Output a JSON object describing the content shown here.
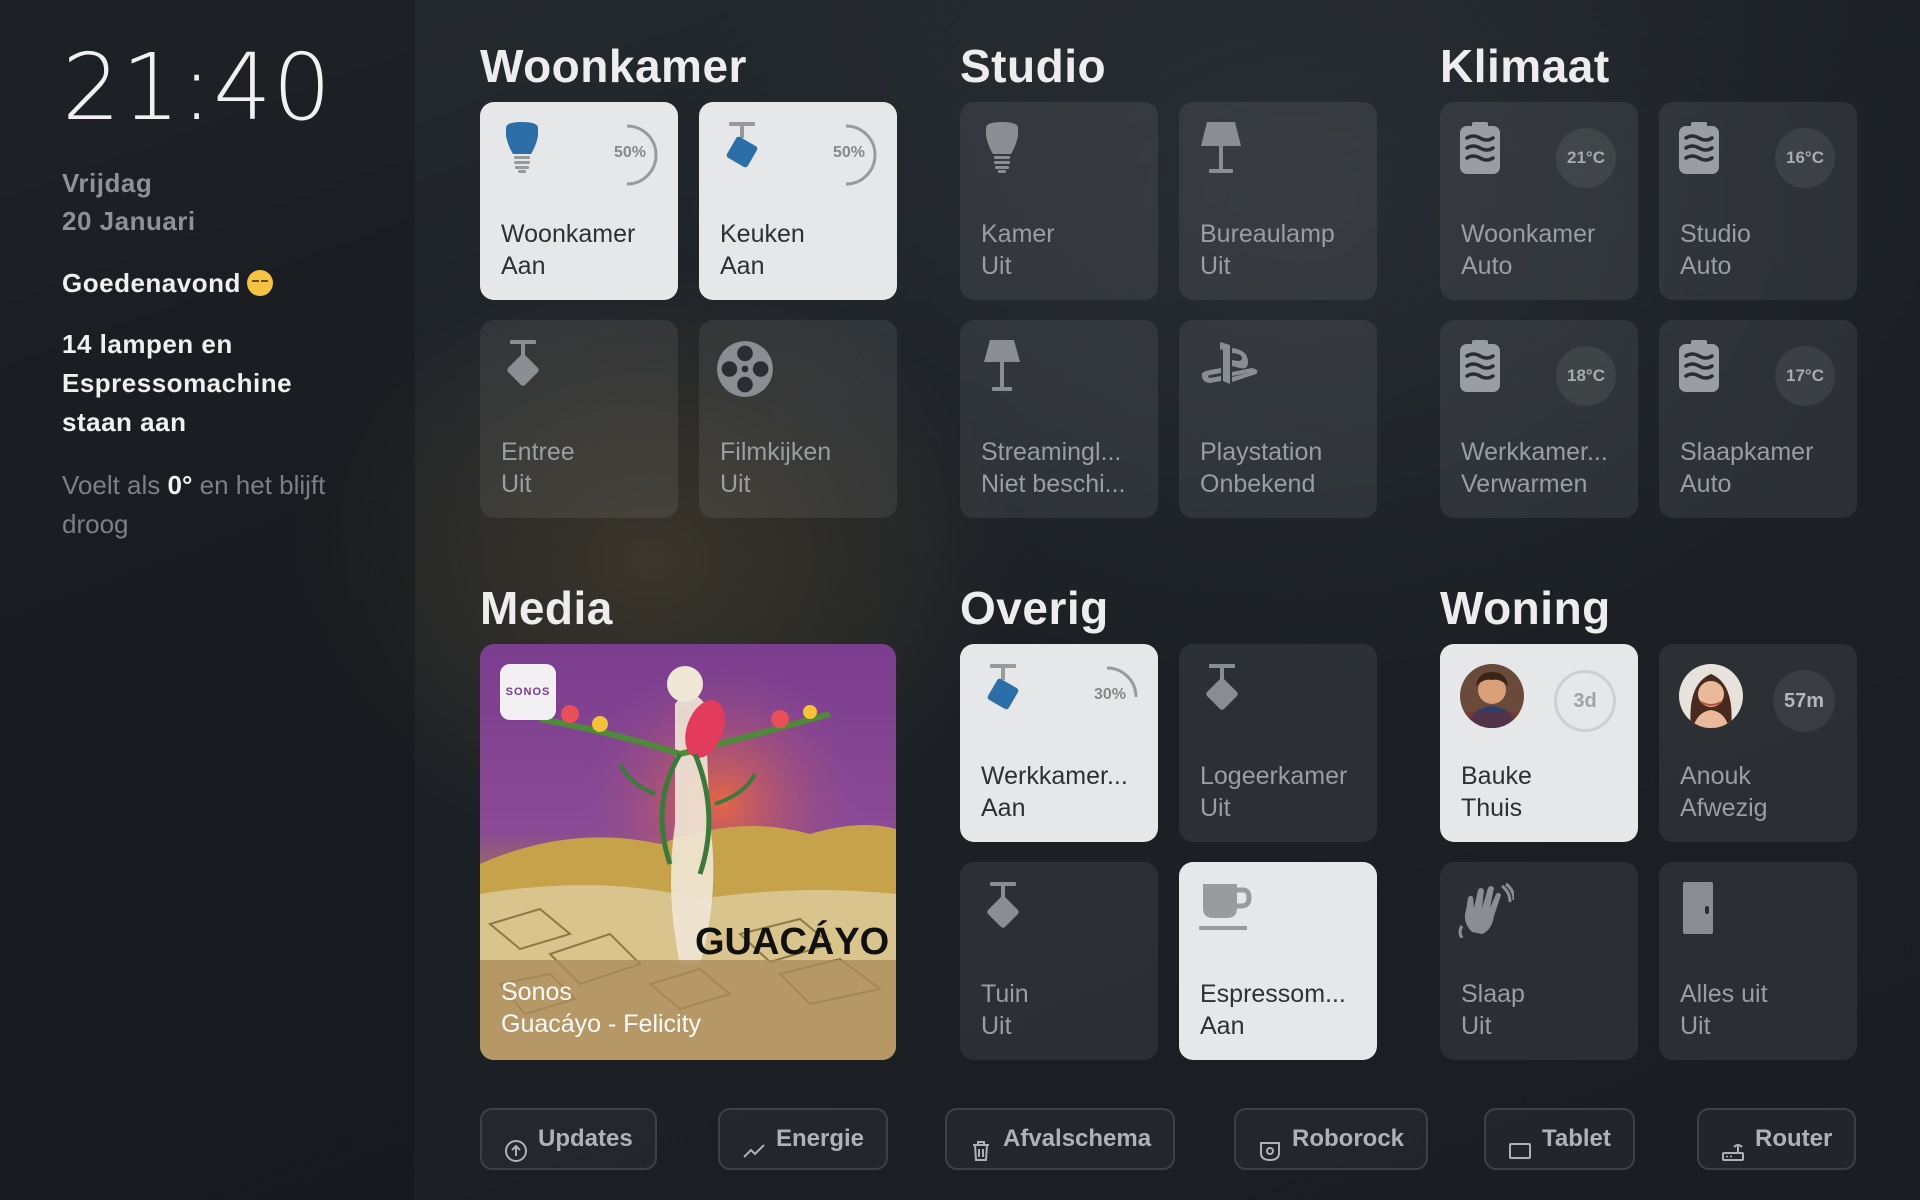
{
  "sidebar": {
    "time": "21:40",
    "day": "Vrijdag",
    "date": "20 Januari",
    "greeting": "Goedenavond",
    "status": "14 lampen en Espressomachine staan aan",
    "weather_pre": "Voelt als",
    "weather_temp": "0°",
    "weather_post": "en het blijft droog"
  },
  "sections": {
    "woonkamer": {
      "title": "Woonkamer",
      "tiles": [
        {
          "name": "Woonkamer",
          "state": "Aan",
          "on": true,
          "icon": "bulb-icon",
          "brightness": "50%"
        },
        {
          "name": "Keuken",
          "state": "Aan",
          "on": true,
          "icon": "ceiling-light-icon",
          "brightness": "50%"
        },
        {
          "name": "Entree",
          "state": "Uit",
          "on": false,
          "icon": "ceiling-light-icon"
        },
        {
          "name": "Filmkijken",
          "state": "Uit",
          "on": false,
          "icon": "film-reel-icon"
        }
      ]
    },
    "studio": {
      "title": "Studio",
      "tiles": [
        {
          "name": "Kamer",
          "state": "Uit",
          "on": false,
          "icon": "bulb-icon"
        },
        {
          "name": "Bureaulamp",
          "state": "Uit",
          "on": false,
          "icon": "desk-lamp-icon"
        },
        {
          "name": "Streamingl...",
          "state": "Niet beschi...",
          "on": false,
          "icon": "floor-lamp-icon"
        },
        {
          "name": "Playstation",
          "state": "Onbekend",
          "on": false,
          "icon": "playstation-icon"
        }
      ]
    },
    "klimaat": {
      "title": "Klimaat",
      "tiles": [
        {
          "name": "Woonkamer",
          "state": "Auto",
          "temp": "21°C",
          "icon": "radiator-icon"
        },
        {
          "name": "Studio",
          "state": "Auto",
          "temp": "16°C",
          "icon": "radiator-icon"
        },
        {
          "name": "Werkkamer...",
          "state": "Verwarmen",
          "temp": "18°C",
          "icon": "radiator-icon"
        },
        {
          "name": "Slaapkamer",
          "state": "Auto",
          "temp": "17°C",
          "icon": "radiator-icon"
        }
      ]
    },
    "media": {
      "title": "Media",
      "badge": "SONOS",
      "art_text": "GUACÁYO",
      "player": "Sonos",
      "track": "Guacáyo - Felicity"
    },
    "overig": {
      "title": "Overig",
      "tiles": [
        {
          "name": "Werkkamer...",
          "state": "Aan",
          "on": true,
          "icon": "ceiling-light-icon",
          "brightness": "30%"
        },
        {
          "name": "Logeerkamer",
          "state": "Uit",
          "on": false,
          "icon": "ceiling-light-icon"
        },
        {
          "name": "Tuin",
          "state": "Uit",
          "on": false,
          "icon": "ceiling-light-icon"
        },
        {
          "name": "Espressom...",
          "state": "Aan",
          "on": true,
          "icon": "coffee-cup-icon"
        }
      ]
    },
    "woning": {
      "title": "Woning",
      "tiles": [
        {
          "name": "Bauke",
          "state": "Thuis",
          "on": true,
          "badge": "3d",
          "icon": "avatar"
        },
        {
          "name": "Anouk",
          "state": "Afwezig",
          "on": false,
          "badge": "57m",
          "icon": "avatar"
        },
        {
          "name": "Slaap",
          "state": "Uit",
          "on": false,
          "icon": "waving-hand-icon"
        },
        {
          "name": "Alles uit",
          "state": "Uit",
          "on": false,
          "icon": "door-icon"
        }
      ]
    }
  },
  "bottombar": [
    {
      "label": "Updates",
      "icon": "arrow-up-circle-icon"
    },
    {
      "label": "Energie",
      "icon": "trend-line-icon"
    },
    {
      "label": "Afvalschema",
      "icon": "trash-icon"
    },
    {
      "label": "Roborock",
      "icon": "robot-vacuum-icon"
    },
    {
      "label": "Tablet",
      "icon": "tablet-icon"
    },
    {
      "label": "Router",
      "icon": "router-icon"
    }
  ],
  "colors": {
    "tile_on": "#e6e7e8",
    "tile_off": "rgba(255,255,255,0.075)",
    "accent_blue": "#2c6ea8"
  }
}
